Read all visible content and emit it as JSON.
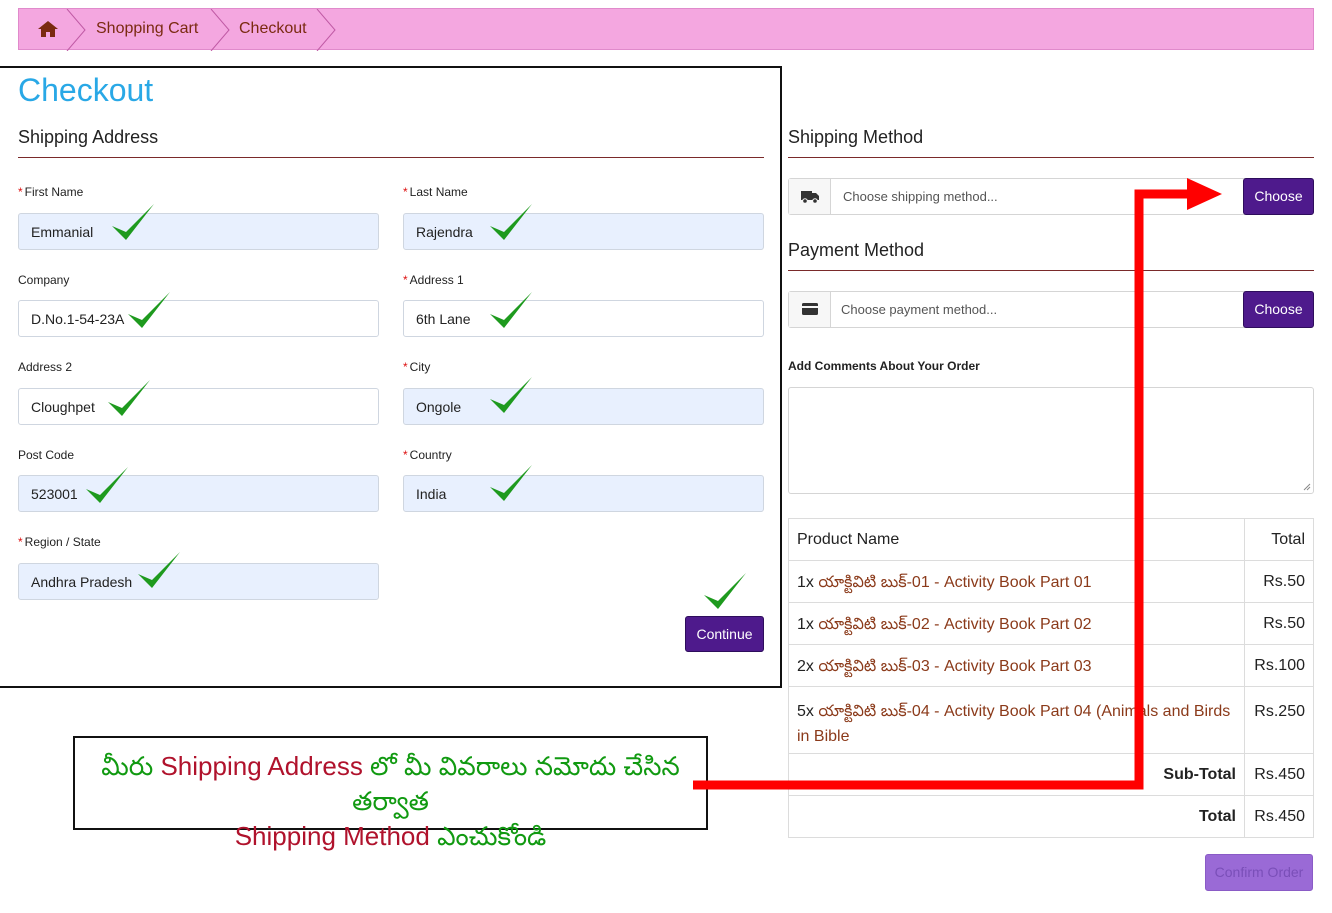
{
  "breadcrumb": {
    "items": [
      "Shopping Cart",
      "Checkout"
    ]
  },
  "page_title": "Checkout",
  "shipping_address": {
    "title": "Shipping Address",
    "fields": {
      "first_name": {
        "label": "First Name",
        "value": "Emmanial",
        "required": true
      },
      "last_name": {
        "label": "Last Name",
        "value": "Rajendra",
        "required": true
      },
      "company": {
        "label": "Company",
        "value": "D.No.1-54-23A",
        "required": false
      },
      "address1": {
        "label": "Address 1",
        "value": "6th Lane",
        "required": true
      },
      "address2": {
        "label": "Address 2",
        "value": "Cloughpet",
        "required": false
      },
      "city": {
        "label": "City",
        "value": "Ongole",
        "required": true
      },
      "post_code": {
        "label": "Post Code",
        "value": "523001",
        "required": false
      },
      "country": {
        "label": "Country",
        "value": "India",
        "required": true
      },
      "region": {
        "label": "Region / State",
        "value": "Andhra Pradesh",
        "required": true
      }
    },
    "continue_label": "Continue"
  },
  "shipping_method": {
    "title": "Shipping Method",
    "placeholder": "Choose shipping method...",
    "button": "Choose"
  },
  "payment_method": {
    "title": "Payment Method",
    "placeholder": "Choose payment method...",
    "button": "Choose"
  },
  "comments": {
    "label": "Add Comments About Your Order"
  },
  "order": {
    "headers": {
      "product": "Product Name",
      "total": "Total"
    },
    "rows": [
      {
        "qty": "1x",
        "name": "యాక్టివిటి బుక్-01 - Activity Book Part 01",
        "total": "Rs.50"
      },
      {
        "qty": "1x",
        "name": "యాక్టివిటి బుక్-02 - Activity Book Part 02",
        "total": "Rs.50"
      },
      {
        "qty": "2x",
        "name": "యాక్టివిటి బుక్-03 - Activity Book Part 03",
        "total": "Rs.100"
      },
      {
        "qty": "5x",
        "name": "యాక్టివిటి బుక్-04 - Activity Book Part 04 (Animals and Birds in Bible",
        "total": "Rs.250"
      }
    ],
    "subtotal_label": "Sub-Total",
    "subtotal": "Rs.450",
    "total_label": "Total",
    "total": "Rs.450"
  },
  "confirm_label": "Confirm Order",
  "annotation": {
    "part1": "మీరు ",
    "part2": "Shipping Address",
    "part3": " లో మీ వివరాలు నమోదు చేసిన తర్వాత",
    "part4": "Shipping Method",
    "part5": " ఎంచుకోండి"
  },
  "colors": {
    "breadcrumb_bg": "#f4a7e0",
    "title_blue": "#29a8e6",
    "button_purple": "#4e1a8c",
    "link_brown": "#8b3a1a",
    "check_green": "#1e9a1e",
    "arrow_red": "#ff0000"
  }
}
